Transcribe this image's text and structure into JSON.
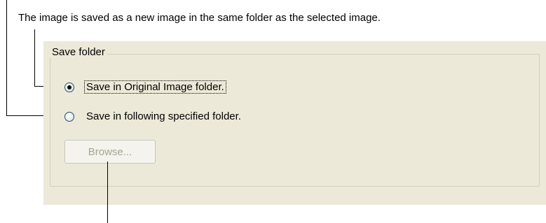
{
  "annotation": {
    "text": "The image is saved as a new image in the same folder as the selected image."
  },
  "save_folder": {
    "title": "Save folder",
    "options": [
      {
        "label": "Save in Original Image folder.",
        "selected": true
      },
      {
        "label": "Save in following specified folder.",
        "selected": false
      }
    ],
    "browse_label": "Browse...",
    "browse_enabled": false
  }
}
